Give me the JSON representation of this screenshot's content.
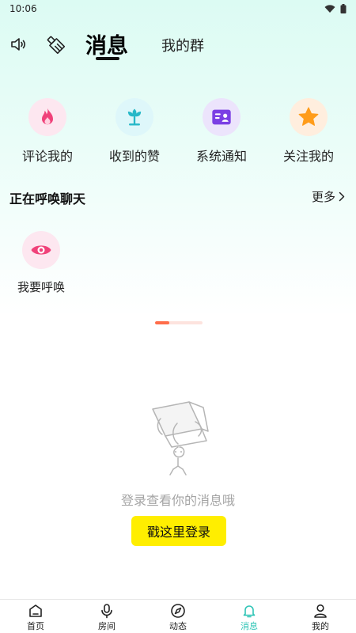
{
  "status": {
    "time": "10:06"
  },
  "header": {
    "tabs": [
      {
        "label": "消息",
        "active": true
      },
      {
        "label": "我的群",
        "active": false
      }
    ]
  },
  "quick_actions": [
    {
      "label": "评论我的",
      "icon": "flame-icon",
      "color": "#f0427a",
      "bg": "#fde7f0"
    },
    {
      "label": "收到的赞",
      "icon": "lotus-icon",
      "color": "#26b8c8",
      "bg": "#def7fa"
    },
    {
      "label": "系统通知",
      "icon": "id-card-icon",
      "color": "#7b3fe4",
      "bg": "#ece4fc"
    },
    {
      "label": "关注我的",
      "icon": "star-icon",
      "color": "#ff9c1a",
      "bg": "#ffeede"
    }
  ],
  "calling_section": {
    "title": "正在呼唤聊天",
    "more_label": "更多",
    "item": {
      "label": "我要呼唤",
      "icon": "eye-icon",
      "color": "#f0427a",
      "bg": "#fde7f0"
    }
  },
  "carousel": {
    "progress": 0.3,
    "color": "#ff6d4a"
  },
  "empty_state": {
    "text": "登录查看你的消息哦",
    "login_button": "戳这里登录",
    "button_color": "#ffee00"
  },
  "bottom_nav": [
    {
      "label": "首页",
      "icon": "home-icon"
    },
    {
      "label": "房间",
      "icon": "mic-icon"
    },
    {
      "label": "动态",
      "icon": "compass-icon"
    },
    {
      "label": "消息",
      "icon": "bell-icon",
      "active": true
    },
    {
      "label": "我的",
      "icon": "person-icon"
    }
  ],
  "colors": {
    "accent": "#2ec4b6",
    "background_top": "#dcfbf3"
  }
}
